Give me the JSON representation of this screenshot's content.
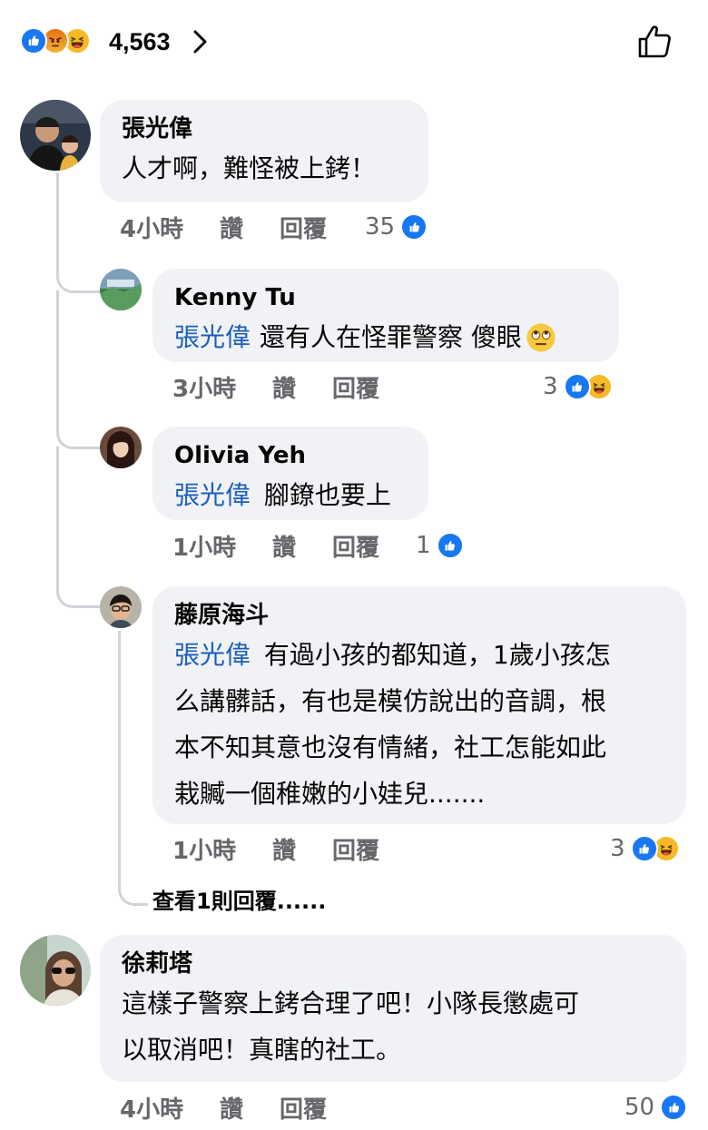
{
  "header": {
    "reaction_count": "4,563",
    "reactions": [
      "like-icon",
      "angry-icon",
      "haha-icon"
    ]
  },
  "comments": [
    {
      "author": "張光偉",
      "lines": [
        "人才啊，難怪被上銬！"
      ],
      "time": "4小時",
      "like_label": "讚",
      "reply_label": "回覆",
      "reaction_count": "35",
      "reactions": [
        "like-icon"
      ],
      "replies": [
        {
          "author": "Kenny Tu",
          "mention": "張光偉",
          "lines": [
            "還有人在怪罪警察 傻眼"
          ],
          "emoji": "eye-roll-emoji-icon",
          "time": "3小時",
          "like_label": "讚",
          "reply_label": "回覆",
          "reaction_count": "3",
          "reactions": [
            "like-icon",
            "haha-icon"
          ]
        },
        {
          "author": "Olivia Yeh",
          "mention": "張光偉",
          "lines": [
            "腳鐐也要上"
          ],
          "time": "1小時",
          "like_label": "讚",
          "reply_label": "回覆",
          "reaction_count": "1",
          "reactions": [
            "like-icon"
          ]
        },
        {
          "author": "藤原海斗",
          "mention": "張光偉",
          "lines": [
            "有過小孩的都知道，1歲小孩怎",
            "么講髒話，有也是模仿說出的音調，根",
            "本不知其意也沒有情緒，社工怎能如此",
            "栽贓一個稚嫩的小娃兒......."
          ],
          "time": "1小時",
          "like_label": "讚",
          "reply_label": "回覆",
          "reaction_count": "3",
          "reactions": [
            "like-icon",
            "haha-icon"
          ],
          "view_more": "查看1則回覆......"
        }
      ]
    },
    {
      "author": "徐莉塔",
      "lines": [
        "這樣子警察上銬合理了吧！小隊長懲處可",
        "以取消吧！真瞎的社工。"
      ],
      "time": "4小時",
      "like_label": "讚",
      "reply_label": "回覆",
      "reaction_count": "50",
      "reactions": [
        "like-icon"
      ]
    }
  ],
  "colors": {
    "like_blue": "#1877f2",
    "mention_blue": "#1b5fb8",
    "bubble_bg": "#f0f2f5",
    "meta_gray": "#65676b",
    "haha_yellow": "#f7b928"
  }
}
